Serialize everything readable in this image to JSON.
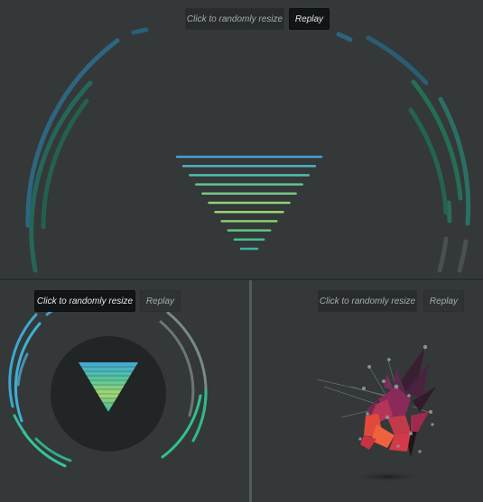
{
  "panels": [
    {
      "id": "top",
      "resize_label": "Click to randomly resize",
      "replay_label": "Replay",
      "bars": [
        {
          "color": "#4a9ed4"
        },
        {
          "color": "#4fb0c0"
        },
        {
          "color": "#55bba8"
        },
        {
          "color": "#63c293"
        },
        {
          "color": "#77c984"
        },
        {
          "color": "#8ed07a"
        },
        {
          "color": "#9bd473"
        },
        {
          "color": "#86cf72"
        },
        {
          "color": "#5fc67f"
        },
        {
          "color": "#45bf8e"
        },
        {
          "color": "#35b6a6"
        }
      ]
    },
    {
      "id": "bottom-left",
      "resize_label": "Click to randomly resize",
      "replay_label": "Replay"
    },
    {
      "id": "bottom-right",
      "resize_label": "Click to randomly resize",
      "replay_label": "Replay"
    }
  ],
  "colors": {
    "background": "#343838",
    "arc_blue": "#2e6a87",
    "arc_green": "#246e54",
    "arc_gray": "#4a4f4f",
    "bright_blue": "#3fb0d6",
    "bright_green": "#35c49a",
    "circle_fill": "#222525",
    "crystal_red": "#e04a3c",
    "crystal_magenta": "#a32a5a",
    "crystal_purple": "#5a1e44"
  }
}
